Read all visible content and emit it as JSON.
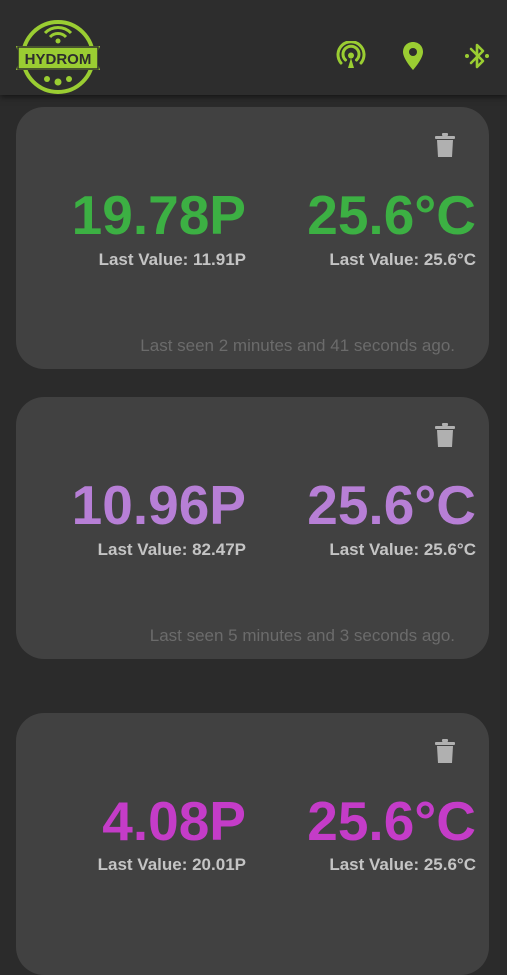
{
  "app": {
    "logo_text": "HYDROM",
    "header_icons": [
      "wireless-icon",
      "location-pin-icon",
      "bluetooth-icon"
    ],
    "accent_color": "#9acd32"
  },
  "cards": [
    {
      "gravity": "19.78P",
      "temperature": "25.6°C",
      "last_gravity": "Last Value: 11.91P",
      "last_temperature": "Last Value: 25.6°C",
      "last_seen": "Last seen 2 minutes and 41 seconds ago.",
      "color": "#3cb043"
    },
    {
      "gravity": "10.96P",
      "temperature": "25.6°C",
      "last_gravity": "Last Value: 82.47P",
      "last_temperature": "Last Value: 25.6°C",
      "last_seen": "Last seen 5 minutes and 3 seconds ago.",
      "color": "#b77fd6"
    },
    {
      "gravity": "4.08P",
      "temperature": "25.6°C",
      "last_gravity": "Last Value: 20.01P",
      "last_temperature": "Last Value: 25.6°C",
      "last_seen": "",
      "color": "#c43cc8"
    }
  ]
}
